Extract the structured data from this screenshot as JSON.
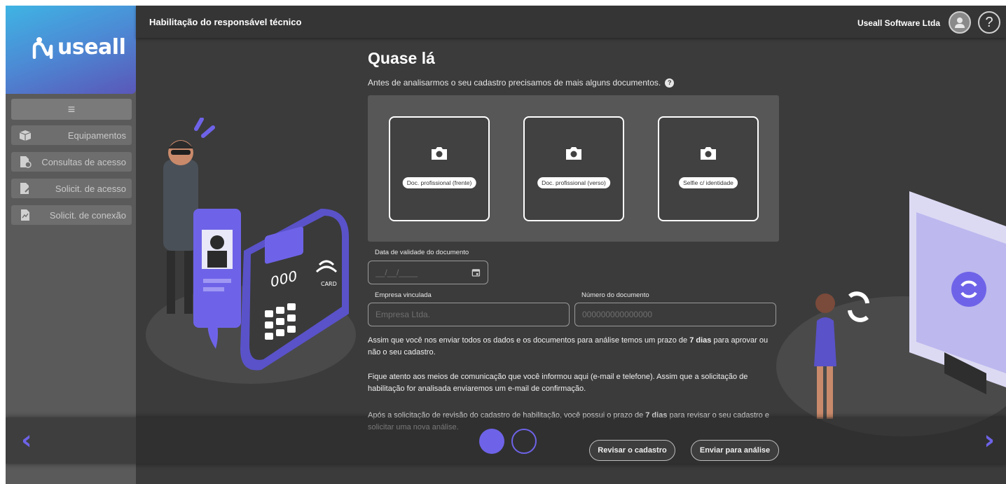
{
  "sidebar": {
    "logo_text": "useall",
    "menu_icon": "hamburger-icon",
    "items": [
      {
        "label": "Equipamentos",
        "icon": "box-icon"
      },
      {
        "label": "Consultas de acesso",
        "icon": "file-check-icon"
      },
      {
        "label": "Solicit. de acesso",
        "icon": "file-edit-icon"
      },
      {
        "label": "Solicit. de conexão",
        "icon": "file-chart-icon"
      }
    ]
  },
  "header": {
    "title": "Habilitação do responsável técnico",
    "company": "Useall Software Ltda",
    "help_label": "?"
  },
  "main": {
    "title": "Quase lá",
    "subtitle": "Antes de analisarmos o seu cadastro precisamos de mais alguns documentos.",
    "subtitle_help": "?",
    "uploads": [
      {
        "label": "Doc. profissional (frente)"
      },
      {
        "label": "Doc. profissional (verso)"
      },
      {
        "label": "Selfie c/ identidade"
      }
    ],
    "validity": {
      "label": "Data de validade do documento",
      "placeholder": "__/__/____"
    },
    "company_field": {
      "label": "Empresa vinculada",
      "placeholder": "Empresa Ltda."
    },
    "doc_number_field": {
      "label": "Número do documento",
      "placeholder": "000000000000000"
    },
    "para1": {
      "pre": "Assim que você nos enviar todos os dados e os documentos para análise temos um prazo de ",
      "bold": "7 dias",
      "post": " para aprovar ou não o seu cadastro."
    },
    "para2": "Fique atento aos meios de comunicação que você informou aqui (e-mail e telefone). Assim que a solicitação de habilitação for analisada enviaremos um e-mail de confirmação.",
    "para3": {
      "pre": "Após a solicitação de revisão do cadastro de habilitação, você possui o prazo de ",
      "bold": "7 dias",
      "post": " para revisar o seu cadastro e solicitar uma nova análise."
    }
  },
  "footer": {
    "prev": "‹",
    "next": "›",
    "review_button": "Revisar o cadastro",
    "submit_button": "Enviar para análise"
  },
  "illustration": {
    "terminal_display": "000",
    "card_text": "CARD"
  },
  "colors": {
    "accent": "#6e63e8",
    "background": "#3b3b3b",
    "sidebar": "#5a5a5a"
  }
}
